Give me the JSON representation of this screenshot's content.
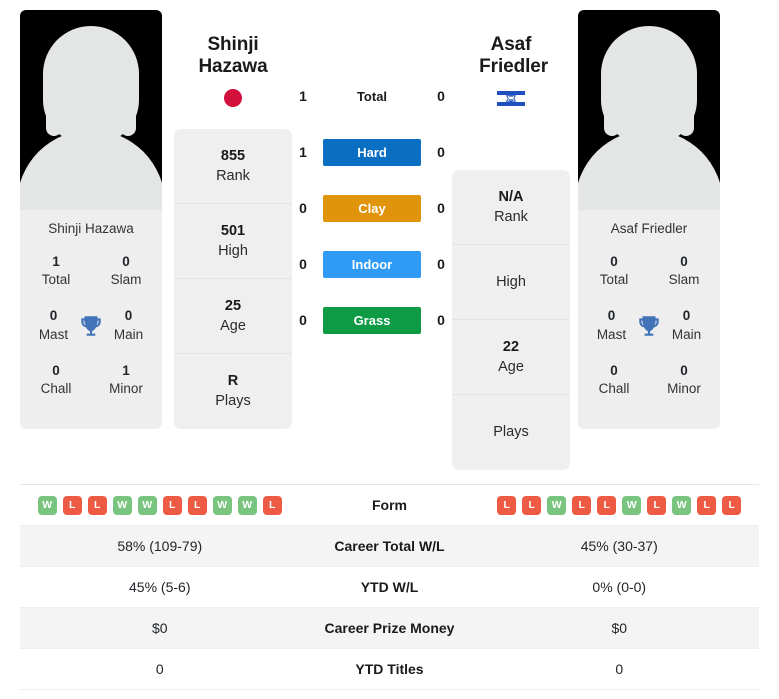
{
  "players": {
    "left": {
      "first_name": "Shinji",
      "last_name": "Hazawa",
      "full_name": "Shinji Hazawa",
      "flag": "japan-flag",
      "photo_label": "player-photo-placeholder",
      "titles": {
        "total_value": "1",
        "total_label": "Total",
        "slam_value": "0",
        "slam_label": "Slam",
        "mast_value": "0",
        "mast_label": "Mast",
        "main_value": "0",
        "main_label": "Main",
        "chall_value": "0",
        "chall_label": "Chall",
        "minor_value": "1",
        "minor_label": "Minor"
      },
      "card": [
        {
          "value": "855",
          "label": "Rank"
        },
        {
          "value": "501",
          "label": "High"
        },
        {
          "value": "25",
          "label": "Age"
        },
        {
          "value": "R",
          "label": "Plays"
        }
      ],
      "form": [
        "W",
        "L",
        "L",
        "W",
        "W",
        "L",
        "L",
        "W",
        "W",
        "L"
      ],
      "career_total_wl": "58% (109-79)",
      "ytd_wl": "45% (5-6)",
      "career_prize_money": "$0",
      "ytd_titles": "0"
    },
    "right": {
      "first_name": "Asaf",
      "last_name": "Friedler",
      "full_name": "Asaf Friedler",
      "flag": "israel-flag",
      "photo_label": "player-photo-placeholder",
      "titles": {
        "total_value": "0",
        "total_label": "Total",
        "slam_value": "0",
        "slam_label": "Slam",
        "mast_value": "0",
        "mast_label": "Mast",
        "main_value": "0",
        "main_label": "Main",
        "chall_value": "0",
        "chall_label": "Chall",
        "minor_value": "0",
        "minor_label": "Minor"
      },
      "card": [
        {
          "value": "N/A",
          "label": "Rank"
        },
        {
          "value": "",
          "label": "High"
        },
        {
          "value": "22",
          "label": "Age"
        },
        {
          "value": "",
          "label": "Plays"
        }
      ],
      "form": [
        "L",
        "L",
        "W",
        "L",
        "L",
        "W",
        "L",
        "W",
        "L",
        "L"
      ],
      "career_total_wl": "45% (30-37)",
      "ytd_wl": "0% (0-0)",
      "career_prize_money": "$0",
      "ytd_titles": "0"
    }
  },
  "h2h": [
    {
      "label": "Total",
      "left": "1",
      "right": "0",
      "color": "",
      "surface": false
    },
    {
      "label": "Hard",
      "left": "1",
      "right": "0",
      "color": "#0a6fc2",
      "surface": true
    },
    {
      "label": "Clay",
      "left": "0",
      "right": "0",
      "color": "#e0940b",
      "surface": true
    },
    {
      "label": "Indoor",
      "left": "0",
      "right": "0",
      "color": "#2f9bf7",
      "surface": true
    },
    {
      "label": "Grass",
      "left": "0",
      "right": "0",
      "color": "#0d9b45",
      "surface": true
    }
  ],
  "table_rows": [
    {
      "label": "Form",
      "type": "form",
      "alt": false
    },
    {
      "label": "Career Total W/L",
      "type": "text",
      "alt": true,
      "key": "career_total_wl"
    },
    {
      "label": "YTD W/L",
      "type": "text",
      "alt": false,
      "key": "ytd_wl"
    },
    {
      "label": "Career Prize Money",
      "type": "text",
      "alt": true,
      "key": "career_prize_money"
    },
    {
      "label": "YTD Titles",
      "type": "text",
      "alt": false,
      "key": "ytd_titles"
    }
  ],
  "colors": {
    "win_badge": "#79c47f",
    "loss_badge": "#ee5b45",
    "card_bg": "#efefef",
    "trophy": "#4273b8",
    "japan_red": "#d2103c",
    "israel_blue": "#1f4fbe"
  }
}
